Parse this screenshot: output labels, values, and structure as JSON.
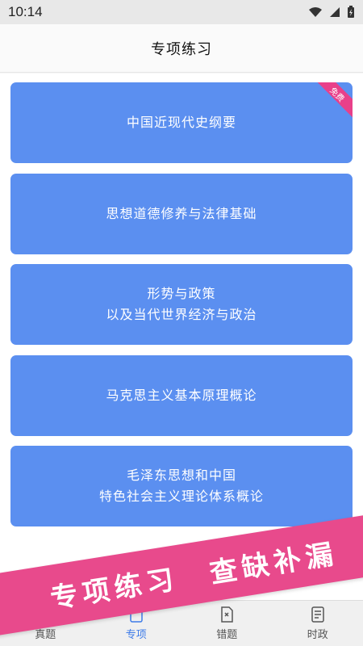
{
  "status_bar": {
    "time": "10:14"
  },
  "header": {
    "title": "专项练习"
  },
  "cards": [
    {
      "lines": [
        "中国近现代史纲要"
      ],
      "badge": "免费"
    },
    {
      "lines": [
        "思想道德修养与法律基础"
      ]
    },
    {
      "lines": [
        "形势与政策",
        "以及当代世界经济与政治"
      ]
    },
    {
      "lines": [
        "马克思主义基本原理概论"
      ]
    },
    {
      "lines": [
        "毛泽东思想和中国",
        "特色社会主义理论体系概论"
      ]
    }
  ],
  "tabbar": {
    "items": [
      {
        "label": "真题"
      },
      {
        "label": "专项"
      },
      {
        "label": "错题"
      },
      {
        "label": "时政"
      }
    ]
  },
  "banner": {
    "left": "专项练习",
    "right": "查缺补漏"
  },
  "colors": {
    "card": "#5b8ff0",
    "accent": "#e84a8c",
    "active_tab": "#3d7be8"
  }
}
